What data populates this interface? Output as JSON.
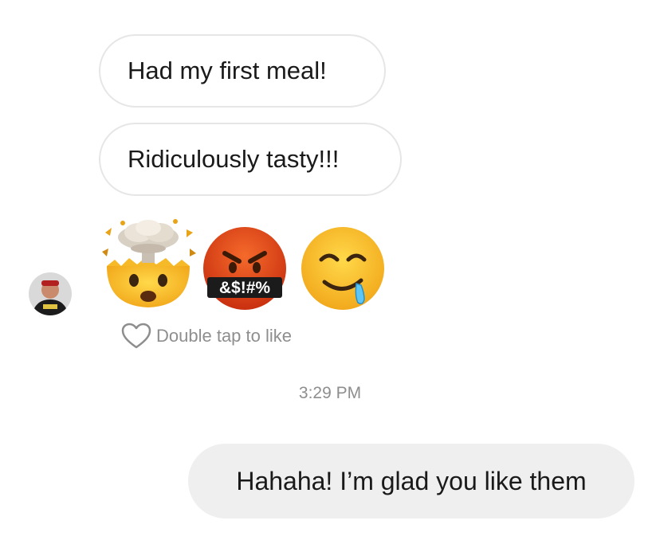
{
  "messages": {
    "incoming_1": "Had my first meal!",
    "incoming_2": "Ridiculously tasty!!!",
    "emojis": [
      "exploding-head",
      "face-with-symbols-on-mouth",
      "drooling-face"
    ],
    "emoji_symbols_text": "&$!#%",
    "like_hint": "Double tap to like",
    "timestamp": "3:29 PM",
    "outgoing_1": "Hahaha! I’m glad you like them"
  },
  "colors": {
    "incoming_border": "#e6e6e6",
    "outgoing_background": "#efefef",
    "muted_text": "#8e8e8e",
    "emoji_yellow": "#f9c32b",
    "emoji_red": "#e3491f"
  },
  "icons": {
    "like": "heart-outline-icon",
    "avatar": "user-avatar"
  }
}
